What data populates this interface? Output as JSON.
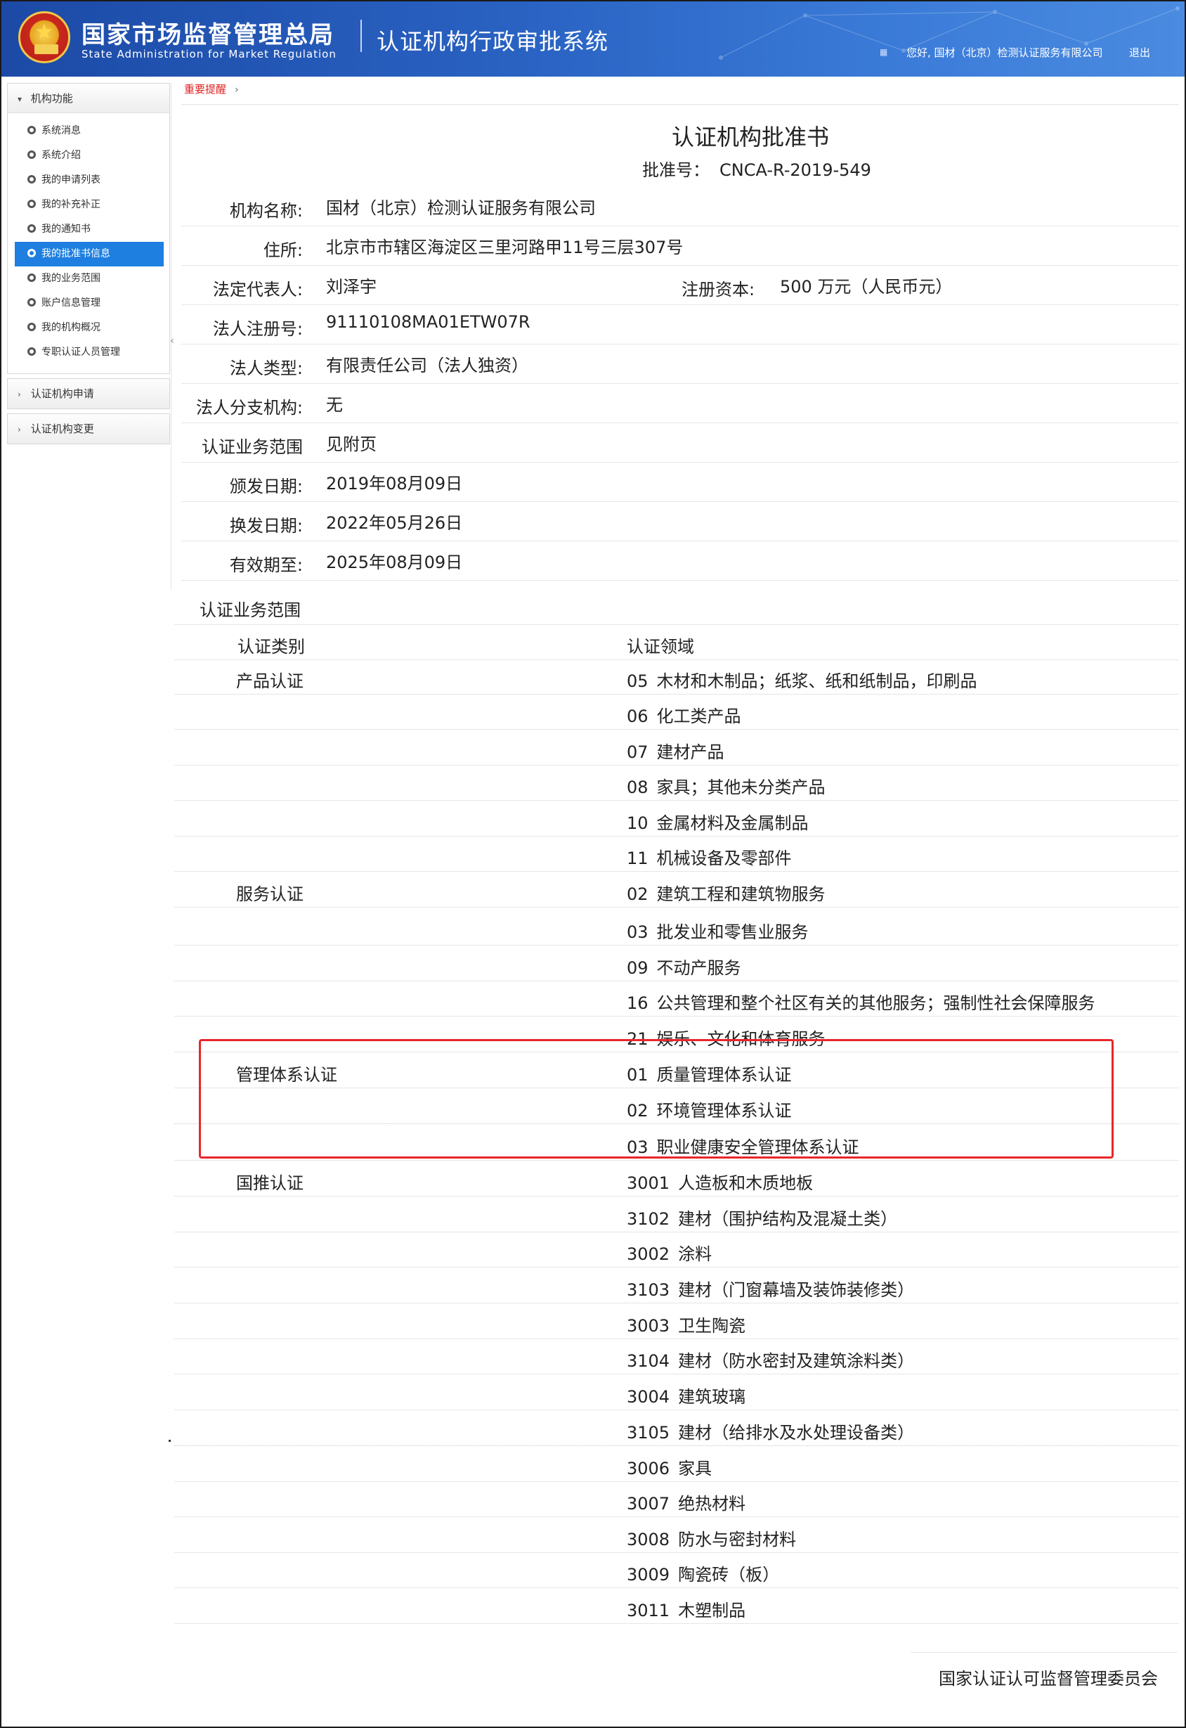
{
  "header": {
    "org_cn": "国家市场监督管理总局",
    "org_en": "State Administration  for  Market Regulation",
    "system_title": "认证机构行政审批系统",
    "welcome": "您好, 国材（北京）检测认证服务有限公司",
    "logout": "退出"
  },
  "sidebar": {
    "group_title": "机构功能",
    "items": [
      {
        "label": "系统消息"
      },
      {
        "label": "系统介绍"
      },
      {
        "label": "我的申请列表"
      },
      {
        "label": "我的补充补正"
      },
      {
        "label": "我的通知书"
      },
      {
        "label": "我的批准书信息"
      },
      {
        "label": "我的业务范围"
      },
      {
        "label": "账户信息管理"
      },
      {
        "label": "我的机构概况"
      },
      {
        "label": "专职认证人员管理"
      }
    ],
    "collapsed": [
      {
        "label": "认证机构申请"
      },
      {
        "label": "认证机构变更"
      }
    ]
  },
  "breadcrumb": {
    "label": "重要提醒"
  },
  "document": {
    "title": "认证机构批准书",
    "approval_no_label": "批准号：",
    "approval_no": "CNCA-R-2019-549",
    "fields": {
      "org_name_label": "机构名称:",
      "org_name": "国材（北京）检测认证服务有限公司",
      "address_label": "住所:",
      "address": "北京市市辖区海淀区三里河路甲11号三层307号",
      "legal_rep_label": "法定代表人:",
      "legal_rep": "刘泽宇",
      "capital_label": "注册资本:",
      "capital": "500 万元（人民币元）",
      "reg_no_label": "法人注册号:",
      "reg_no": "91110108MA01ETW07R",
      "type_label": "法人类型:",
      "type": "有限责任公司（法人独资）",
      "branch_label": "法人分支机构:",
      "branch": "无",
      "scope_label": "认证业务范围",
      "scope": "见附页",
      "issue_label": "颁发日期:",
      "issue": "2019年08月09日",
      "renew_label": "换发日期:",
      "renew": "2022年05月26日",
      "valid_label": "有效期至:",
      "valid": "2025年08月09日"
    }
  },
  "scope": {
    "title": "认证业务范围",
    "col_category": "认证类别",
    "col_field": "认证领域",
    "rows": [
      {
        "category": "产品认证",
        "code": "05",
        "field": "木材和木制品；纸浆、纸和纸制品，印刷品"
      },
      {
        "category": "",
        "code": "06",
        "field": "化工类产品"
      },
      {
        "category": "",
        "code": "07",
        "field": "建材产品"
      },
      {
        "category": "",
        "code": "08",
        "field": "家具；其他未分类产品"
      },
      {
        "category": "",
        "code": "10",
        "field": "金属材料及金属制品"
      },
      {
        "category": "",
        "code": "11",
        "field": "机械设备及零部件"
      },
      {
        "category": "服务认证",
        "code": "02",
        "field": "建筑工程和建筑物服务"
      },
      {
        "category": "",
        "code": "03",
        "field": "批发业和零售业服务"
      },
      {
        "category": "",
        "code": "09",
        "field": "不动产服务"
      },
      {
        "category": "",
        "code": "16",
        "field": "公共管理和整个社区有关的其他服务；强制性社会保障服务"
      },
      {
        "category": "",
        "code": "21",
        "field": "娱乐、文化和体育服务"
      },
      {
        "category": "管理体系认证",
        "code": "01",
        "field": "质量管理体系认证"
      },
      {
        "category": "",
        "code": "02",
        "field": "环境管理体系认证"
      },
      {
        "category": "",
        "code": "03",
        "field": "职业健康安全管理体系认证"
      },
      {
        "category": "国推认证",
        "code": "3001",
        "field": "人造板和木质地板"
      },
      {
        "category": "",
        "code": "3102",
        "field": "建材（围护结构及混凝土类）"
      },
      {
        "category": "",
        "code": "3002",
        "field": "涂料"
      },
      {
        "category": "",
        "code": "3103",
        "field": "建材（门窗幕墙及装饰装修类）"
      },
      {
        "category": "",
        "code": "3003",
        "field": "卫生陶瓷"
      },
      {
        "category": "",
        "code": "3104",
        "field": "建材（防水密封及建筑涂料类）"
      },
      {
        "category": "",
        "code": "3004",
        "field": "建筑玻璃"
      },
      {
        "category": "",
        "code": "3105",
        "field": "建材（给排水及水处理设备类）"
      },
      {
        "category": "",
        "code": "3006",
        "field": "家具"
      },
      {
        "category": "",
        "code": "3007",
        "field": "绝热材料"
      },
      {
        "category": "",
        "code": "3008",
        "field": "防水与密封材料"
      },
      {
        "category": "",
        "code": "3009",
        "field": "陶瓷砖（板）"
      },
      {
        "category": "",
        "code": "3011",
        "field": "木塑制品"
      }
    ]
  },
  "footer": {
    "org": "国家认证认可监督管理委员会"
  },
  "colors": {
    "header_blue": "#1c4aa6",
    "active_item": "#1e7fe0",
    "highlight_red": "#e8262b",
    "breadcrumb_red": "#e02020"
  }
}
